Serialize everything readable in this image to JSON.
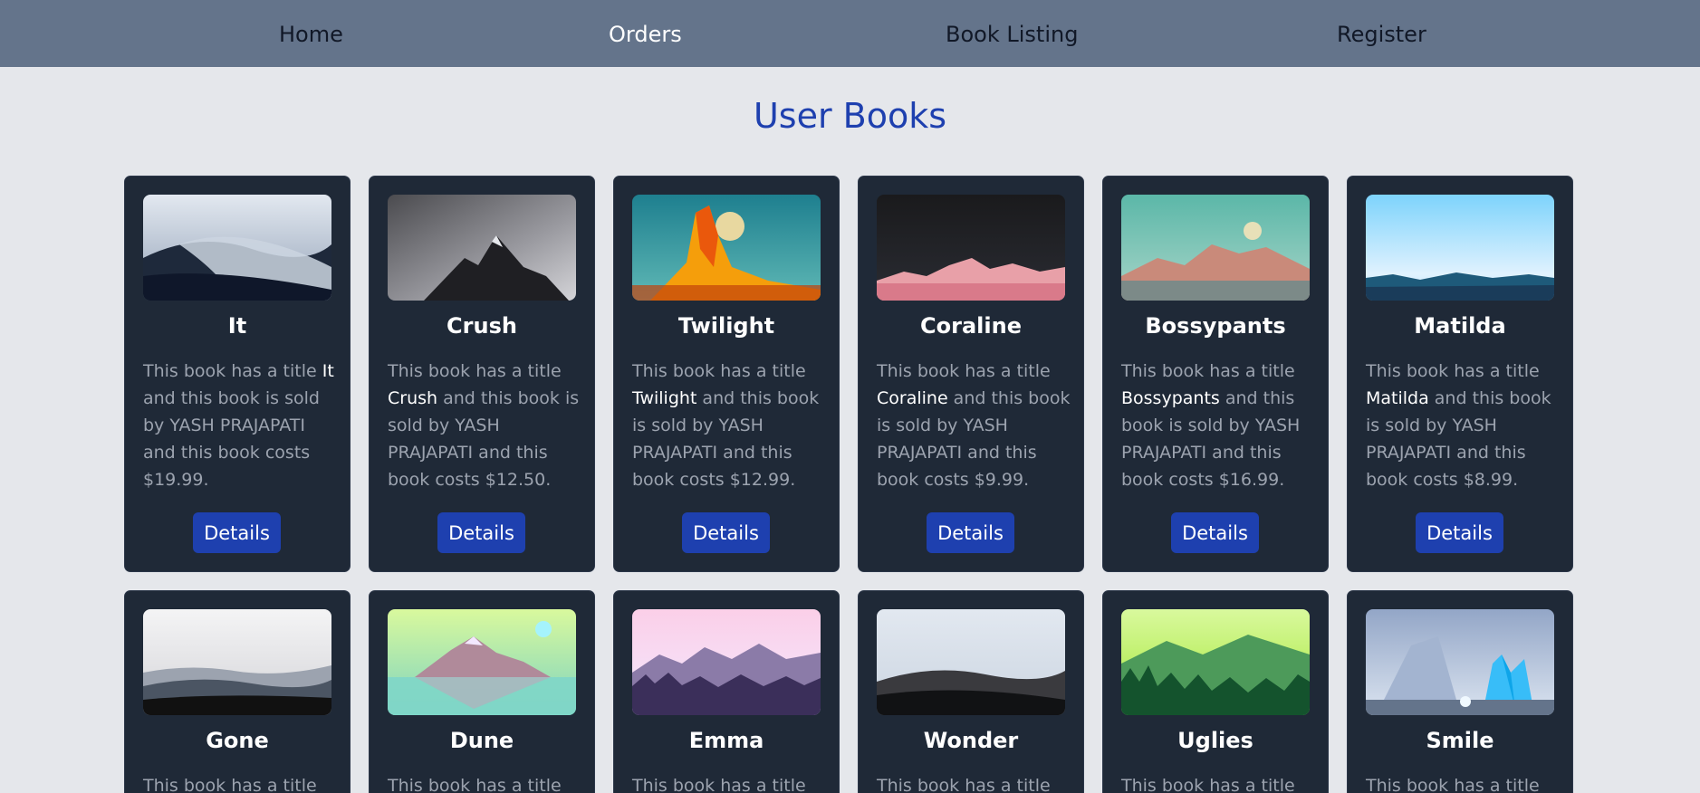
{
  "nav": {
    "items": [
      {
        "label": "Home",
        "active": false
      },
      {
        "label": "Orders",
        "active": true
      },
      {
        "label": "Book Listing",
        "active": false
      },
      {
        "label": "Register",
        "active": false
      }
    ]
  },
  "page": {
    "title": "User Books"
  },
  "colors": {
    "nav_bg": "#64748b",
    "page_bg": "#e5e7eb",
    "card_bg": "#1f2937",
    "accent": "#1e40af"
  },
  "desc_template": {
    "prefix": "This book has a title ",
    "middle": " and this book is sold by ",
    "middle2": " and this book costs ",
    "suffix": "."
  },
  "books": [
    {
      "title": "It",
      "seller": "YASH PRAJAPATI",
      "price": "$19.99",
      "image": "desert-dunes-night",
      "button": "Details"
    },
    {
      "title": "Crush",
      "seller": "YASH PRAJAPATI",
      "price": "$12.50",
      "image": "grey-mountain-peak",
      "button": "Details"
    },
    {
      "title": "Twilight",
      "seller": "YASH PRAJAPATI",
      "price": "$12.99",
      "image": "orange-rock-tower",
      "button": "Details"
    },
    {
      "title": "Coraline",
      "seller": "YASH PRAJAPATI",
      "price": "$9.99",
      "image": "pink-mountains-dark-sky",
      "button": "Details"
    },
    {
      "title": "Bossypants",
      "seller": "YASH PRAJAPATI",
      "price": "$16.99",
      "image": "teal-mountain-range",
      "button": "Details"
    },
    {
      "title": "Matilda",
      "seller": "YASH PRAJAPATI",
      "price": "$8.99",
      "image": "blue-sky-horizon",
      "button": "Details"
    },
    {
      "title": "Gone",
      "image": "monochrome-hills"
    },
    {
      "title": "Dune",
      "image": "pastel-mountain-lake"
    },
    {
      "title": "Emma",
      "image": "purple-forest-mountains"
    },
    {
      "title": "Wonder",
      "image": "grey-dunes"
    },
    {
      "title": "Uglies",
      "image": "green-forest"
    },
    {
      "title": "Smile",
      "image": "blue-crystals"
    }
  ]
}
